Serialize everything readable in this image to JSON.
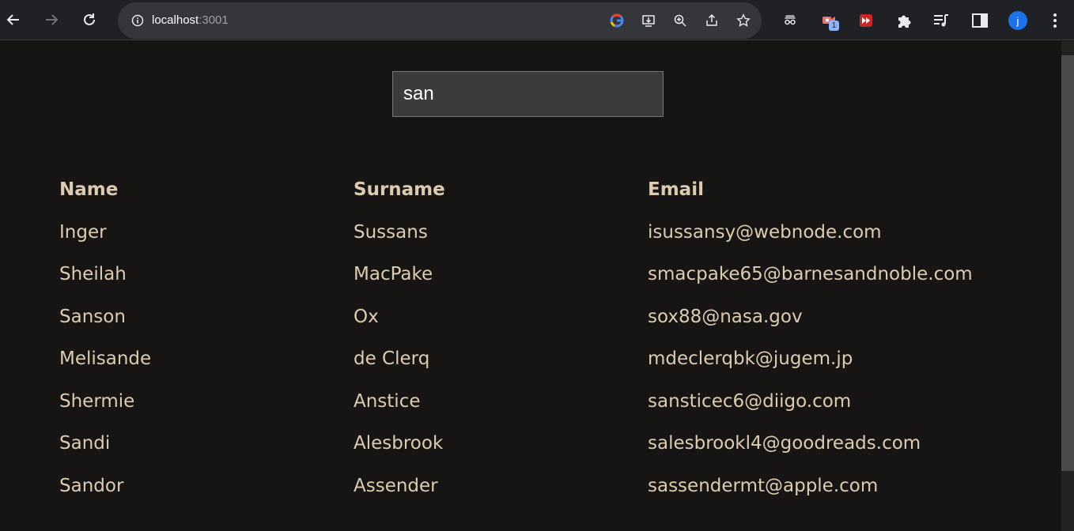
{
  "browser": {
    "url_host": "localhost",
    "url_port": ":3001",
    "profile_initial": "j",
    "extension_badge": "1"
  },
  "search": {
    "value": "san"
  },
  "table": {
    "headers": [
      "Name",
      "Surname",
      "Email"
    ],
    "rows": [
      [
        "Inger",
        "Sussans",
        "isussansy@webnode.com"
      ],
      [
        "Sheilah",
        "MacPake",
        "smacpake65@barnesandnoble.com"
      ],
      [
        "Sanson",
        "Ox",
        "sox88@nasa.gov"
      ],
      [
        "Melisande",
        "de Clerq",
        "mdeclerqbk@jugem.jp"
      ],
      [
        "Shermie",
        "Anstice",
        "sansticec6@diigo.com"
      ],
      [
        "Sandi",
        "Alesbrook",
        "salesbrookl4@goodreads.com"
      ],
      [
        "Sandor",
        "Assender",
        "sassendermt@apple.com"
      ]
    ]
  },
  "colors": {
    "page_bg": "#171514",
    "text": "#dccbb0",
    "input_bg": "#3b3b3b"
  }
}
